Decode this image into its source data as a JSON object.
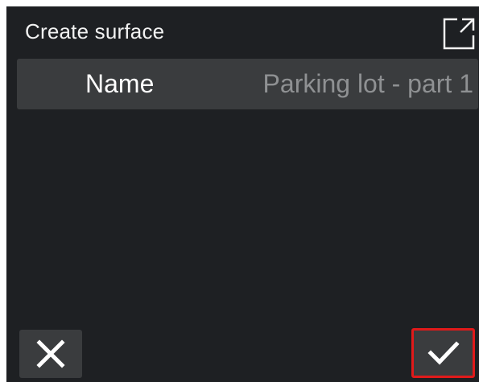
{
  "dialog": {
    "title": "Create surface"
  },
  "fields": {
    "name_label": "Name",
    "name_value": "Parking lot - part 1"
  },
  "icons": {
    "expand": "expand-icon",
    "cancel": "close-icon",
    "confirm": "checkmark-icon"
  },
  "colors": {
    "background": "#1e2023",
    "row_background": "#3a3c3e",
    "value_text": "#8f9193",
    "highlight_border": "#e01a1a"
  }
}
